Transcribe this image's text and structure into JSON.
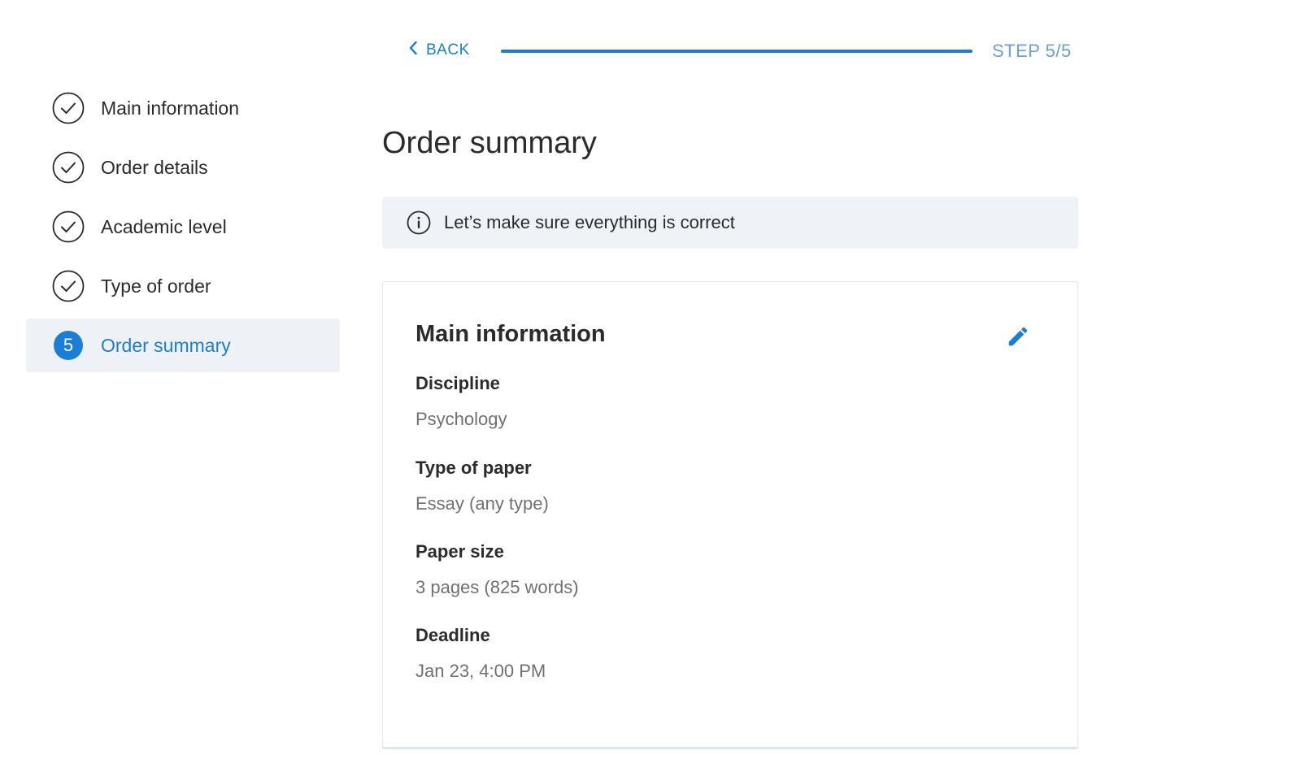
{
  "nav": {
    "back_label": "BACK",
    "progress": 1.0,
    "step_counter": "STEP 5/5"
  },
  "steps": [
    {
      "label": "Main information",
      "status": "completed"
    },
    {
      "label": "Order details",
      "status": "completed"
    },
    {
      "label": "Academic level",
      "status": "completed"
    },
    {
      "label": "Type of order",
      "status": "completed"
    },
    {
      "label": "Order summary",
      "status": "current",
      "number": "5"
    }
  ],
  "main": {
    "title": "Order summary",
    "notice": "Let’s make sure everything is correct",
    "section": {
      "title": "Main information",
      "fields": [
        {
          "label": "Discipline",
          "value": "Psychology"
        },
        {
          "label": "Type of paper",
          "value": "Essay (any type)"
        },
        {
          "label": "Paper size",
          "value": "3 pages (825 words)"
        },
        {
          "label": "Deadline",
          "value": "Jan 23, 4:00 PM"
        }
      ]
    }
  },
  "colors": {
    "accent": "#1a7ed6",
    "active_bg": "#eef2f7",
    "notice_bg": "#eff3f8",
    "muted_text": "#707070"
  },
  "icons": {
    "back": "chevron-left-icon",
    "completed_step": "check-circle-icon",
    "notice": "info-icon",
    "edit": "pencil-icon"
  }
}
